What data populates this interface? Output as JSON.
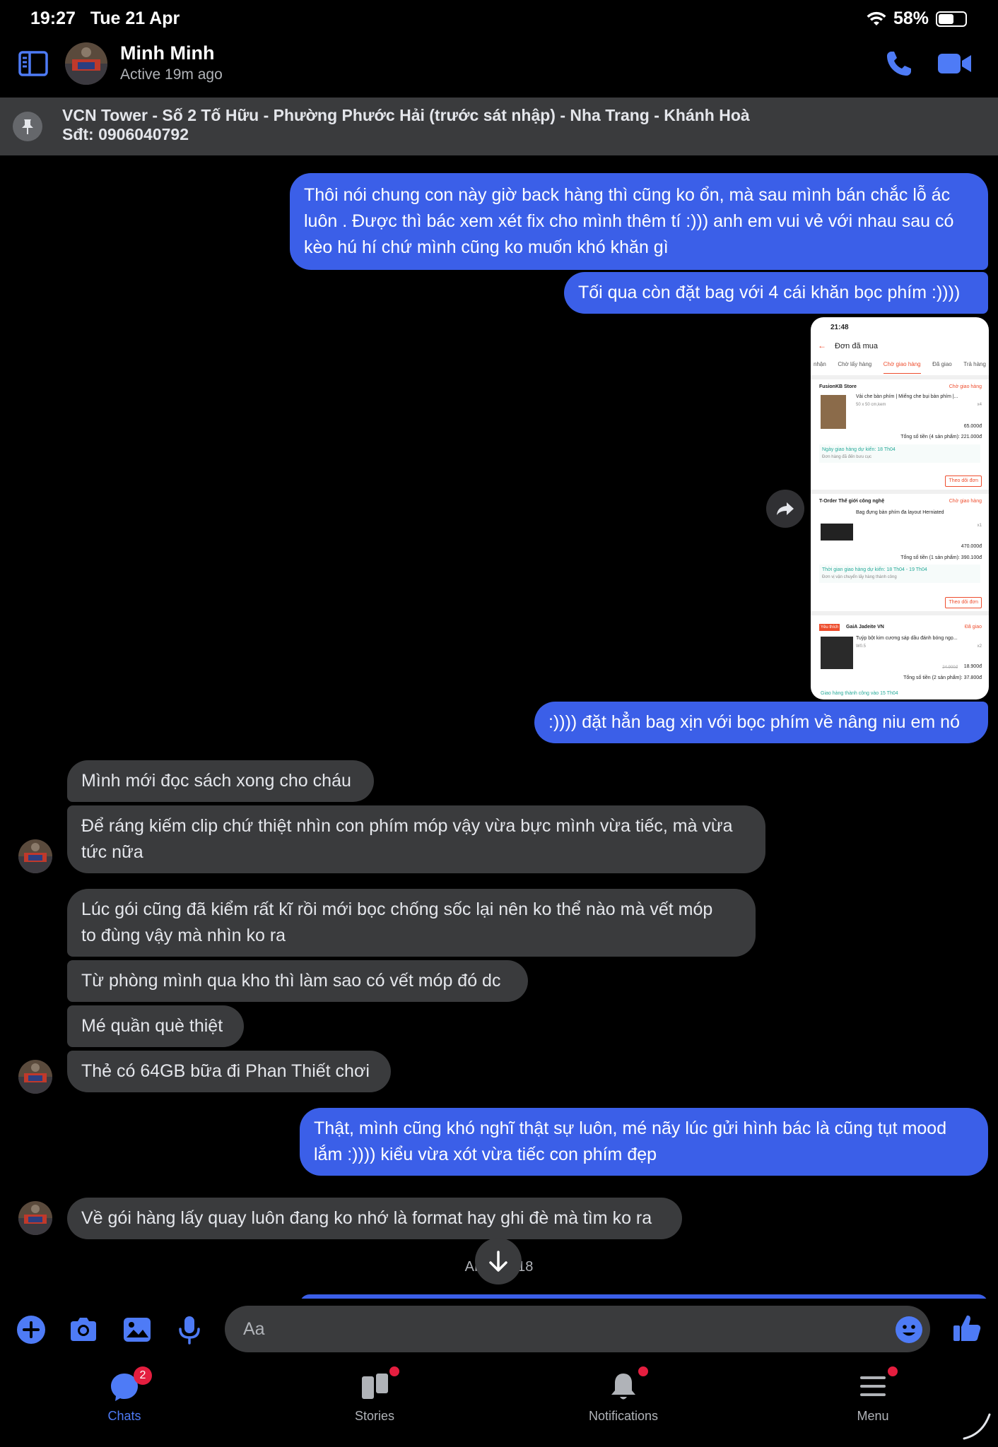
{
  "status_bar": {
    "time": "19:27",
    "date": "Tue 21 Apr",
    "battery": "58%",
    "battery_level": 0.58
  },
  "header": {
    "contact_name": "Minh Minh",
    "contact_status": "Active 19m ago"
  },
  "pinned": {
    "line1": "VCN Tower - Số 2 Tố Hữu - Phường Phước Hải (trước sát nhập) - Nha Trang - Khánh Hoà",
    "line2": "Sđt: 0906040792"
  },
  "messages": {
    "m1_line1": "Thôi nói chung con này giờ back hàng thì cũng ko ổn, mà sau mình bán chắc lỗ ác",
    "m1_line2": "luôn . Được thì bác xem xét fix cho mình thêm tí :))) anh em vui vẻ với nhau sau có",
    "m1_line3": "kèo hú hí chứ mình cũng ko muốn khó khăn gì",
    "m2": "Tối qua còn đặt bag với 4 cái khăn bọc phím :))))",
    "m3": ":)))) đặt hẳn bag xịn với bọc phím về nâng niu em nó",
    "m4": "Mình mới đọc sách xong cho cháu",
    "m5_line1": "Để ráng kiếm clip chứ thiệt nhìn con phím móp vậy vừa bực mình vừa tiếc, mà vừa",
    "m5_line2": "tức nữa",
    "m6_line1": "Lúc gói cũng đã kiểm rất kĩ rồi mới bọc chống sốc lại nên ko thể nào mà vết móp",
    "m6_line2": "to đùng vậy mà nhìn ko ra",
    "m7": "Từ phòng mình qua kho thì làm sao có vết móp đó dc",
    "m8": "Mé quần què thiệt",
    "m9": "Thẻ có 64GB bữa đi Phan Thiết chơi",
    "m10_line1": "Thật, mình cũng khó nghĩ thật sự luôn, mé nãy lúc gửi hình bác là cũng tụt mood",
    "m10_line2": "lắm :)))) kiểu vừa xót vừa tiếc con phím đẹp",
    "m11": "Về gói hàng lấy quay luôn đang ko nhớ là format hay ghi đè mà tìm ko ra",
    "timestamp": "APR 22:18"
  },
  "screenshot": {
    "time": "21:48",
    "title": "Đơn đã mua",
    "tabs": [
      "nhận",
      "Chờ lấy hàng",
      "Chờ giao hàng",
      "Đã giao",
      "Trả hàng"
    ],
    "store1": "FusionKB Store",
    "store1_status": "Chờ giao hàng",
    "item1": "Vải che bàn phím | Miếng che bụi bàn phím |...",
    "item1_variant": "50 x 50 cm,kem",
    "item1_qty": "x4",
    "item1_price": "65.000đ",
    "item1_total": "Tổng số tiền (4 sản phẩm): 221.000đ",
    "ship1": "Ngày giao hàng dự kiến: 18 Th04",
    "ship1_sub": "Đơn hàng đã đến bưu cục",
    "btn1": "Theo dõi đơn",
    "store2": "T-Order Thế giới công nghệ",
    "store2_status": "Chờ giao hàng",
    "item2": "Bag đựng bàn phím đa layout Herniated",
    "item2_qty": "x1",
    "item2_price": "470.000đ",
    "item2_total": "Tổng số tiền (1 sản phẩm): 390.100đ",
    "ship2": "Thời gian giao hàng dự kiến: 18 Th04 - 19 Th04",
    "ship2_sub": "Đơn vị vận chuyển lấy hàng thành công",
    "btn2": "Theo dõi đơn",
    "store3_tag": "Yêu thích",
    "store3": "GaiA Jadeite VN",
    "store3_status": "Đã giao",
    "item3": "Tuýp bột kim cương sáp dầu đánh bóng ngọ...",
    "item3_variant": "W0.5",
    "item3_qty": "x2",
    "item3_old_price": "24.900đ",
    "item3_price": "18.900đ",
    "item3_total": "Tổng số tiền (2 sản phẩm): 37.800đ",
    "ship3": "Giao hàng thành công vào 15 Th04"
  },
  "composer": {
    "placeholder": "Aa"
  },
  "tabs": {
    "chats": "Chats",
    "chats_badge": "2",
    "stories": "Stories",
    "notifications": "Notifications",
    "menu": "Menu"
  },
  "colors": {
    "accent": "#3b5fe8",
    "icon_blue": "#4e7bf6",
    "incoming": "#3a3b3d",
    "badge": "#e41e3f"
  }
}
